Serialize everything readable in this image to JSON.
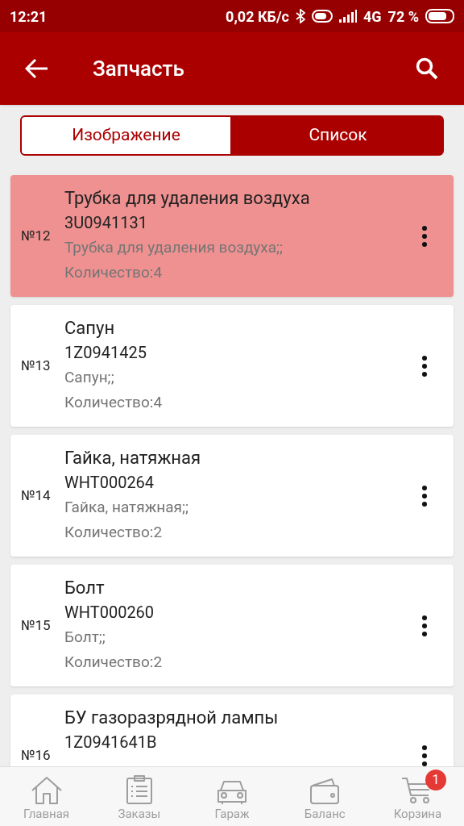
{
  "status_bar": {
    "time": "12:21",
    "speed": "0,02 КБ/с",
    "network": "4G",
    "battery": "72 %"
  },
  "app_bar": {
    "title": "Запчасть"
  },
  "view_toggle": [
    {
      "label": "Изображение",
      "selected": false
    },
    {
      "label": "Список",
      "selected": true
    }
  ],
  "parts": [
    {
      "number": "№12",
      "title": "Трубка для удаления воздуха",
      "code": "3U0941131",
      "description": "Трубка для удаления воздуха;;",
      "quantity": "Количество:4",
      "selected": true
    },
    {
      "number": "№13",
      "title": "Сапун",
      "code": "1Z0941425",
      "description": "Сапун;;",
      "quantity": "Количество:4",
      "selected": false
    },
    {
      "number": "№14",
      "title": "Гайка, натяжная",
      "code": "WHT000264",
      "description": "Гайка, натяжная;;",
      "quantity": "Количество:2",
      "selected": false
    },
    {
      "number": "№15",
      "title": "Болт",
      "code": "WHT000260",
      "description": "Болт;;",
      "quantity": "Количество:2",
      "selected": false
    },
    {
      "number": "№16",
      "title": "БУ газоразрядной лампы",
      "code": "1Z0941641B",
      "selected": false
    }
  ],
  "bottom_nav": [
    {
      "label": "Главная",
      "kind": "home"
    },
    {
      "label": "Заказы",
      "kind": "orders"
    },
    {
      "label": "Гараж",
      "kind": "garage"
    },
    {
      "label": "Баланс",
      "kind": "balance"
    },
    {
      "label": "Корзина",
      "kind": "cart",
      "badge": "1"
    }
  ]
}
